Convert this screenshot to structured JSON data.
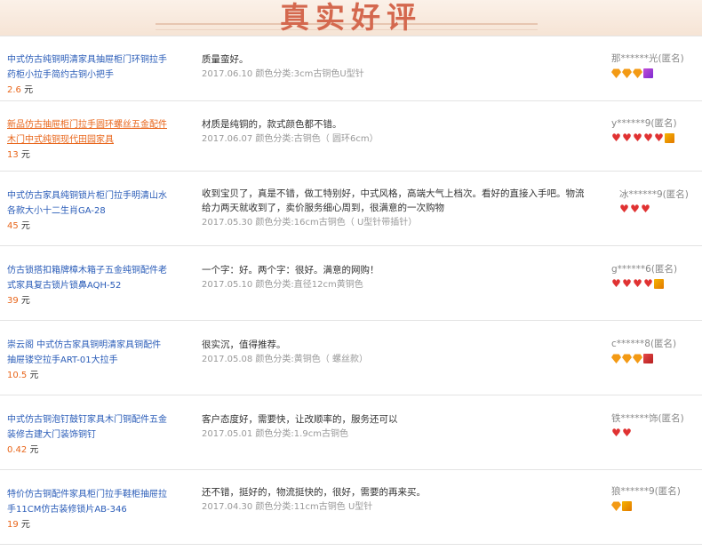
{
  "banner": {
    "title": "真实好评"
  },
  "reviews": [
    {
      "product": "中式仿古纯铜明清家具抽屉柜门环铜拉手药柜小拉手简约古铜小把手",
      "price": "2.6",
      "price_unit": "元",
      "text": "质量蛮好。",
      "meta": "2017.06.10 颜色分类:3cm古铜色U型针",
      "user": "那******光(匿名)",
      "badges": [
        "diamond",
        "diamond",
        "diamond",
        "crown-purple"
      ]
    },
    {
      "product": "新品仿古抽屉柜门拉手圆环螺丝五金配件木门中式纯铜现代田园家具",
      "price": "13",
      "price_unit": "元",
      "text": "材质是纯铜的，款式颜色都不错。",
      "meta": "2017.06.07 颜色分类:古铜色（ 圆环6cm）",
      "user": "y******9(匿名)",
      "badges": [
        "heart",
        "heart",
        "heart",
        "heart",
        "heart",
        "crown-gold"
      ]
    },
    {
      "product": "中式仿古家具纯铜锁片柜门拉手明清山水各款大小十二生肖GA-28",
      "price": "45",
      "price_unit": "元",
      "text": "收到宝贝了，真是不错，做工特别好，中式风格，高端大气上档次。看好的直接入手吧。物流给力两天就收到了，卖价服务细心周到，很满意的一次购物",
      "meta": "2017.05.30 颜色分类:16cm古铜色（ U型针带插针）",
      "user": "冰******9(匿名)",
      "badges": [
        "heart",
        "heart",
        "heart"
      ]
    },
    {
      "product": "仿古锁搭扣箱牌樟木箱子五金纯铜配件老式家具复古锁片锁鼻AQH-52",
      "price": "39",
      "price_unit": "元",
      "text": "一个字：好。两个字：很好。满意的网购！",
      "meta": "2017.05.10 颜色分类:直径12cm黄铜色",
      "user": "g******6(匿名)",
      "badges": [
        "heart",
        "heart",
        "heart",
        "heart",
        "crown-gold"
      ]
    },
    {
      "product": "崇云阁 中式仿古家具铜明清家具铜配件抽屉镂空拉手ART-01大拉手",
      "price": "10.5",
      "price_unit": "元",
      "text": "很实沉，值得推荐。",
      "meta": "2017.05.08 颜色分类:黄铜色（ 螺丝款）",
      "user": "c******8(匿名)",
      "badges": [
        "diamond",
        "diamond",
        "diamond",
        "crown-red"
      ]
    },
    {
      "product": "中式仿古铜泡钉鼓钉家具木门铜配件五金装修古建大门装饰铜钉",
      "price": "0.42",
      "price_unit": "元",
      "text": "客户态度好，需要快，让改顺率的，服务还可以",
      "meta": "2017.05.01 颜色分类:1.9cm古铜色",
      "user": "铁******饰(匿名)",
      "badges": [
        "heart",
        "heart"
      ]
    },
    {
      "product": "特价仿古铜配件家具柜门拉手鞋柜抽屉拉手11CM仿古装修锁片AB-346",
      "price": "19",
      "price_unit": "元",
      "text": "还不错，挺好的，物流挺快的，很好，需要的再来买。",
      "meta": "2017.04.30 颜色分类:11cm古铜色 U型针",
      "user": "狼******9(匿名)",
      "badges": [
        "diamond",
        "crown-gold"
      ]
    }
  ]
}
